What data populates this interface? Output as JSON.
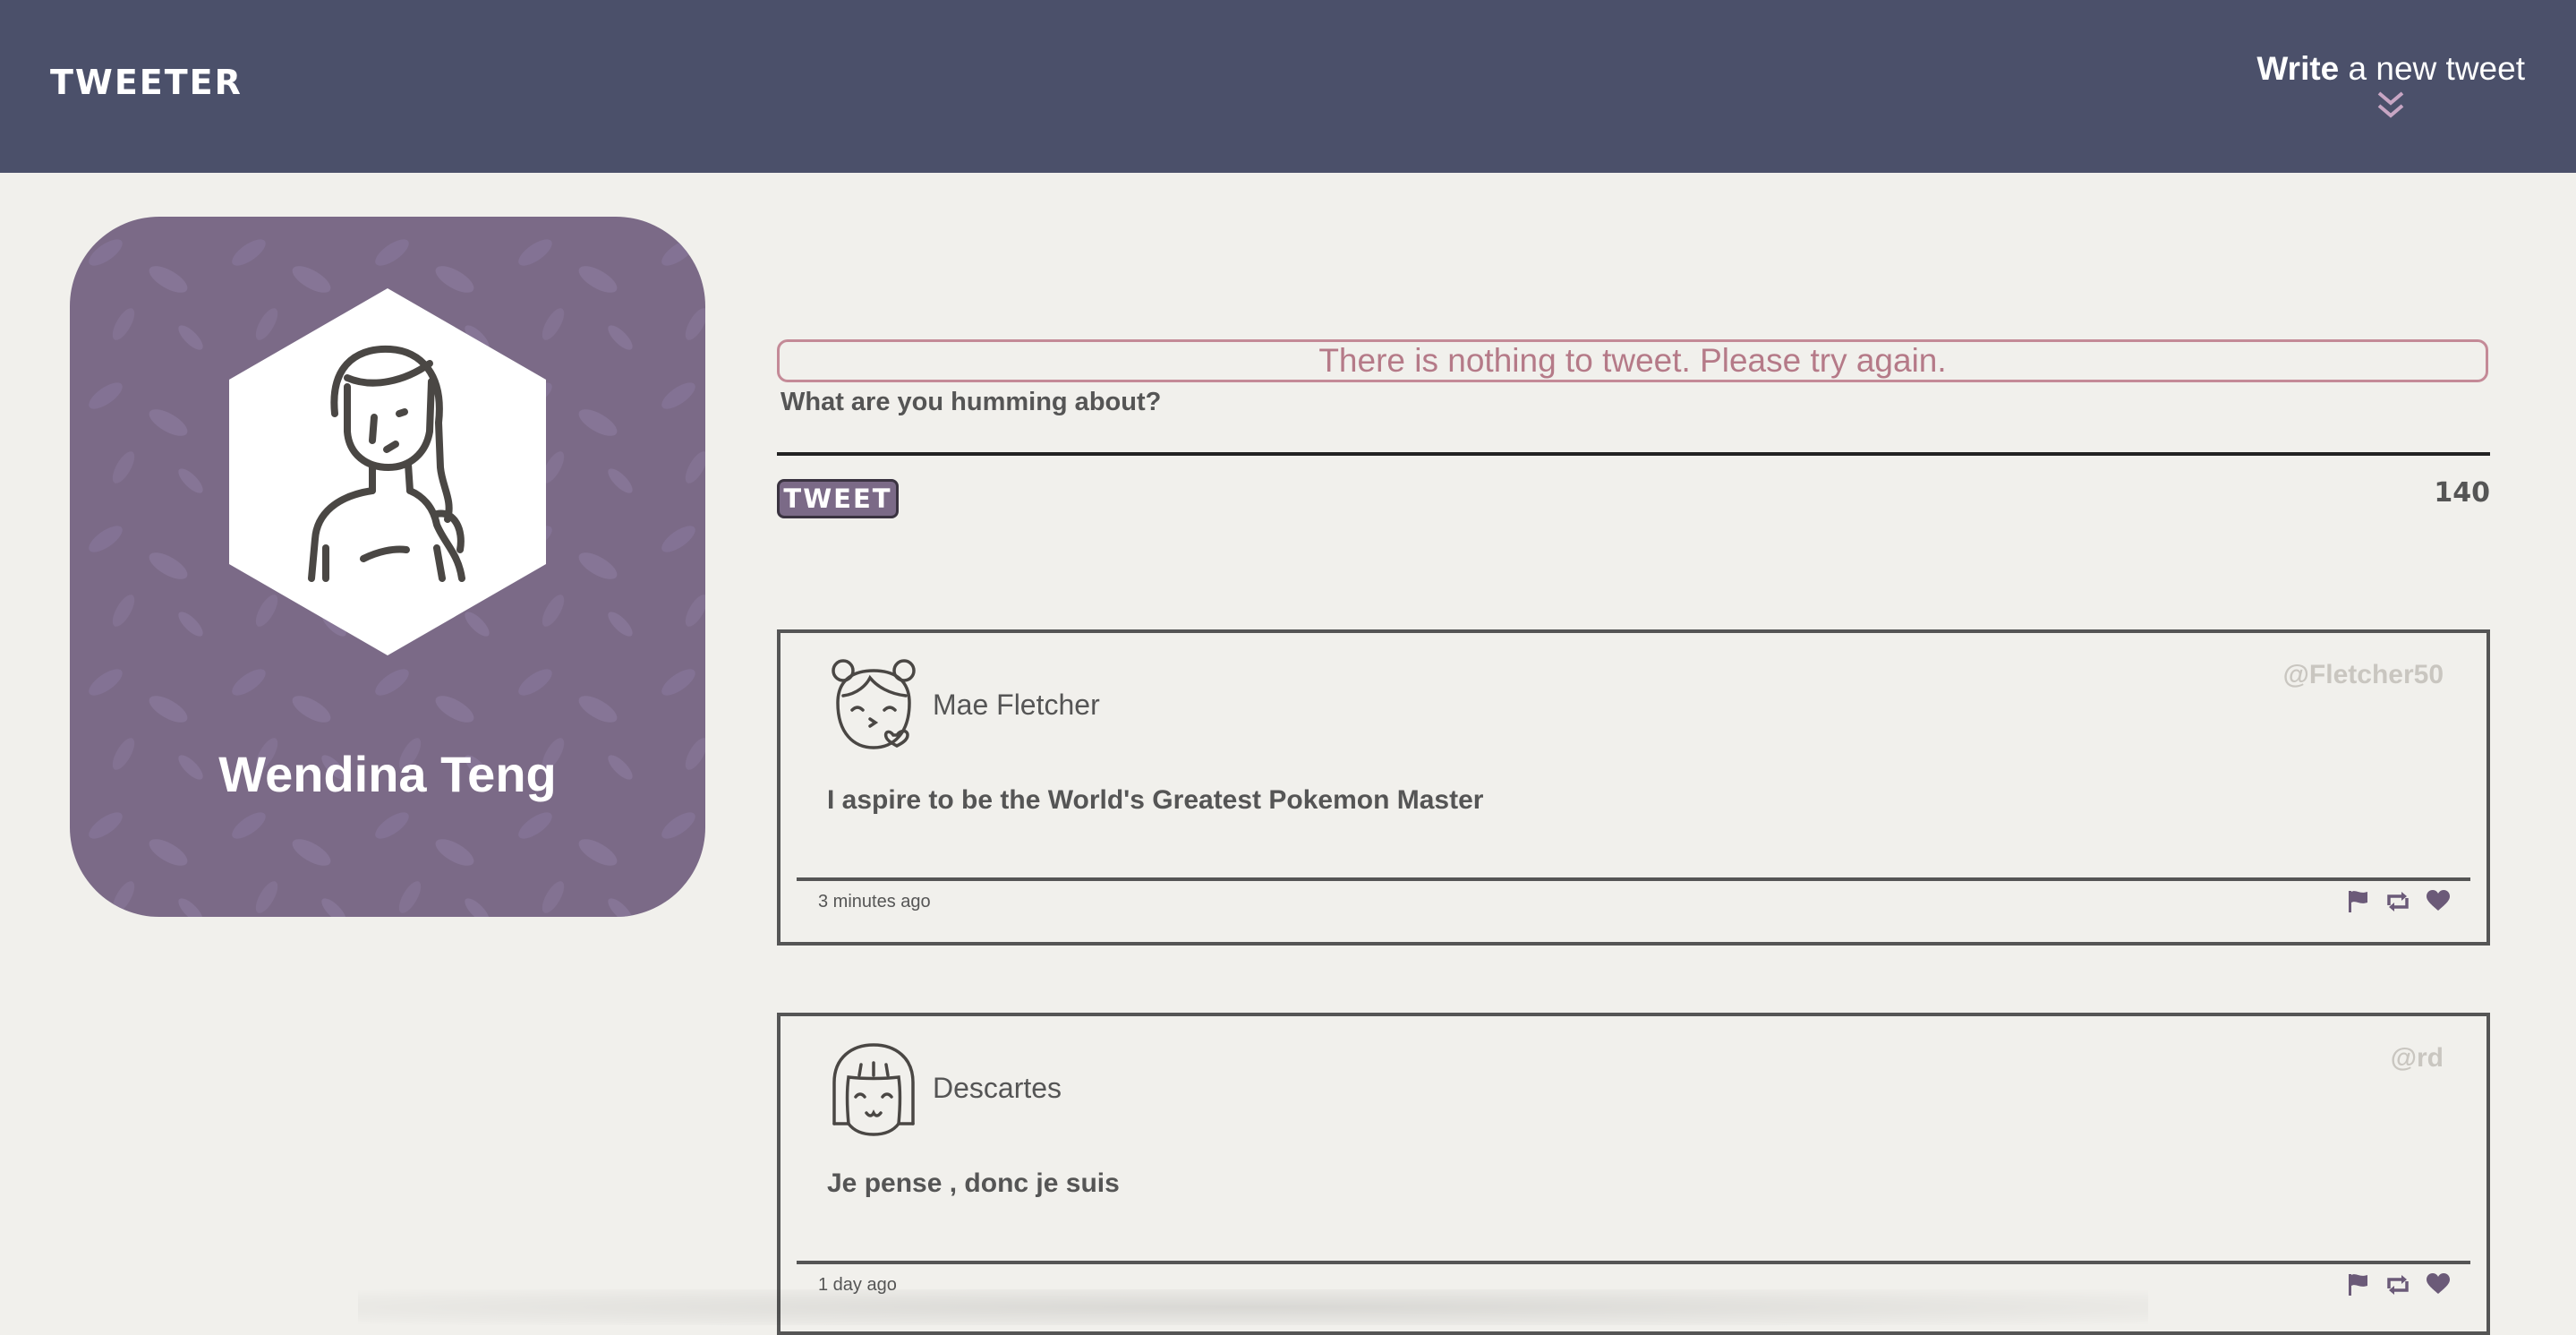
{
  "nav": {
    "brand": "TWEETER",
    "compose_bold": "Write",
    "compose_rest": " a new tweet"
  },
  "profile": {
    "name": "Wendina Teng",
    "bg_color": "#7b6a87"
  },
  "composer": {
    "error": "There is nothing to tweet. Please try again.",
    "prompt": "What are you humming about?",
    "button": "TWEET",
    "counter": "140"
  },
  "tweets": [
    {
      "name": "Mae Fletcher",
      "handle": "@Fletcher50",
      "content": "I aspire to be the World's Greatest Pokemon Master",
      "time": "3 minutes ago",
      "avatar_icon": "girl-kiss-avatar-icon"
    },
    {
      "name": "Descartes",
      "handle": "@rd",
      "content": "Je pense , donc je suis",
      "time": "1 day ago",
      "avatar_icon": "girl-bangs-avatar-icon"
    }
  ],
  "colors": {
    "nav": "#4b506a",
    "accent": "#7b6a87",
    "error": "#c48a97",
    "background": "#f1f0ec"
  }
}
